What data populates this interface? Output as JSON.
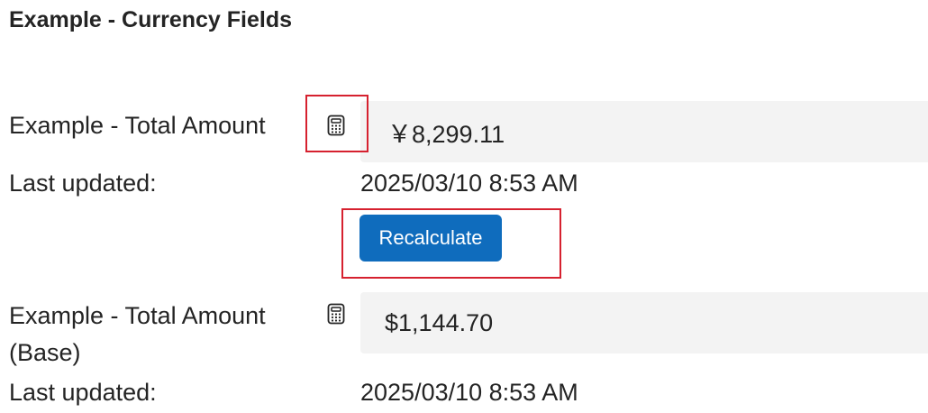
{
  "section": {
    "title": "Example - Currency Fields"
  },
  "fields": [
    {
      "label": "Example - Total Amount",
      "icon": "calculator-icon",
      "value": "￥8,299.11",
      "last_updated_label": "Last updated:",
      "last_updated_value": "2025/03/10 8:53 AM",
      "action_label": "Recalculate"
    },
    {
      "label_line1": "Example - Total Amount",
      "label_line2": "(Base)",
      "icon": "calculator-icon",
      "value": "$1,144.70",
      "last_updated_label": "Last updated:",
      "last_updated_value": "2025/03/10 8:53 AM"
    }
  ],
  "colors": {
    "button_bg": "#0f6cbd",
    "button_text": "#ffffff",
    "field_bg": "#f3f3f3",
    "annotation": "#d6212f",
    "text": "#242424"
  }
}
